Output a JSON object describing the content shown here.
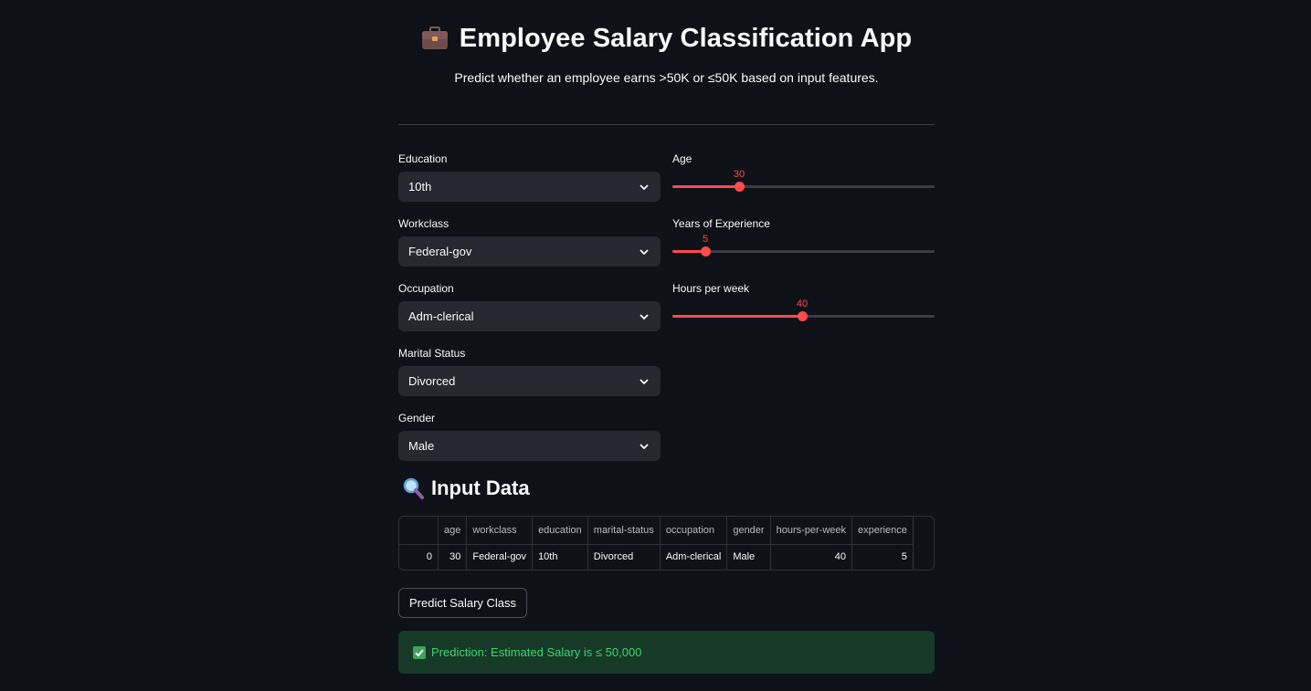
{
  "header": {
    "title": "Employee Salary Classification App",
    "subtitle": "Predict whether an employee earns >50K or ≤50K based on input features.",
    "title_icon": "briefcase-icon"
  },
  "form": {
    "selects": [
      {
        "label": "Education",
        "value": "10th"
      },
      {
        "label": "Workclass",
        "value": "Federal-gov"
      },
      {
        "label": "Occupation",
        "value": "Adm-clerical"
      },
      {
        "label": "Marital Status",
        "value": "Divorced"
      },
      {
        "label": "Gender",
        "value": "Male"
      }
    ],
    "sliders": [
      {
        "label": "Age",
        "value": "30",
        "fraction": 0.255
      },
      {
        "label": "Years of Experience",
        "value": "5",
        "fraction": 0.125
      },
      {
        "label": "Hours per week",
        "value": "40",
        "fraction": 0.495
      }
    ]
  },
  "input_data": {
    "heading": "Input Data",
    "heading_icon": "magnifier-icon",
    "columns": [
      "",
      "age",
      "workclass",
      "education",
      "marital-status",
      "occupation",
      "gender",
      "hours-per-week",
      "experience"
    ],
    "rows": [
      [
        "0",
        "30",
        "Federal-gov",
        "10th",
        "Divorced",
        "Adm-clerical",
        "Male",
        "40",
        "5"
      ]
    ]
  },
  "actions": {
    "predict_label": "Predict Salary Class"
  },
  "result": {
    "text": "Prediction: Estimated Salary is ≤ 50,000"
  },
  "colors": {
    "background": "#0e1117",
    "accent": "#ff4b4b",
    "success_bg": "#173928",
    "success_text": "#3dd56d"
  }
}
